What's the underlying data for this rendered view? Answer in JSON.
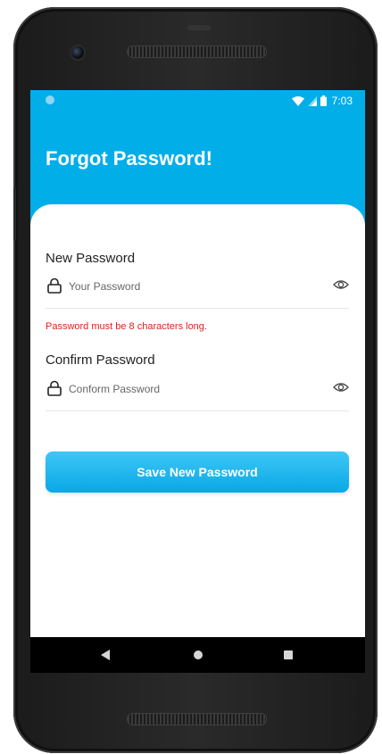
{
  "status_bar": {
    "time": "7:03"
  },
  "header": {
    "title": "Forgot Password!"
  },
  "form": {
    "new_password": {
      "label": "New Password",
      "placeholder": "Your Password",
      "value": "",
      "lock_icon": "lock-icon",
      "toggle_icon": "eye-icon"
    },
    "error": "Password must be 8 characters long.",
    "confirm_password": {
      "label": "Confirm Password",
      "placeholder": "Conform Password",
      "value": "",
      "lock_icon": "lock-icon",
      "toggle_icon": "eye-icon"
    },
    "save_label": "Save New Password"
  },
  "colors": {
    "primary": "#02aee8",
    "error": "#e02020",
    "text": "#222222"
  }
}
